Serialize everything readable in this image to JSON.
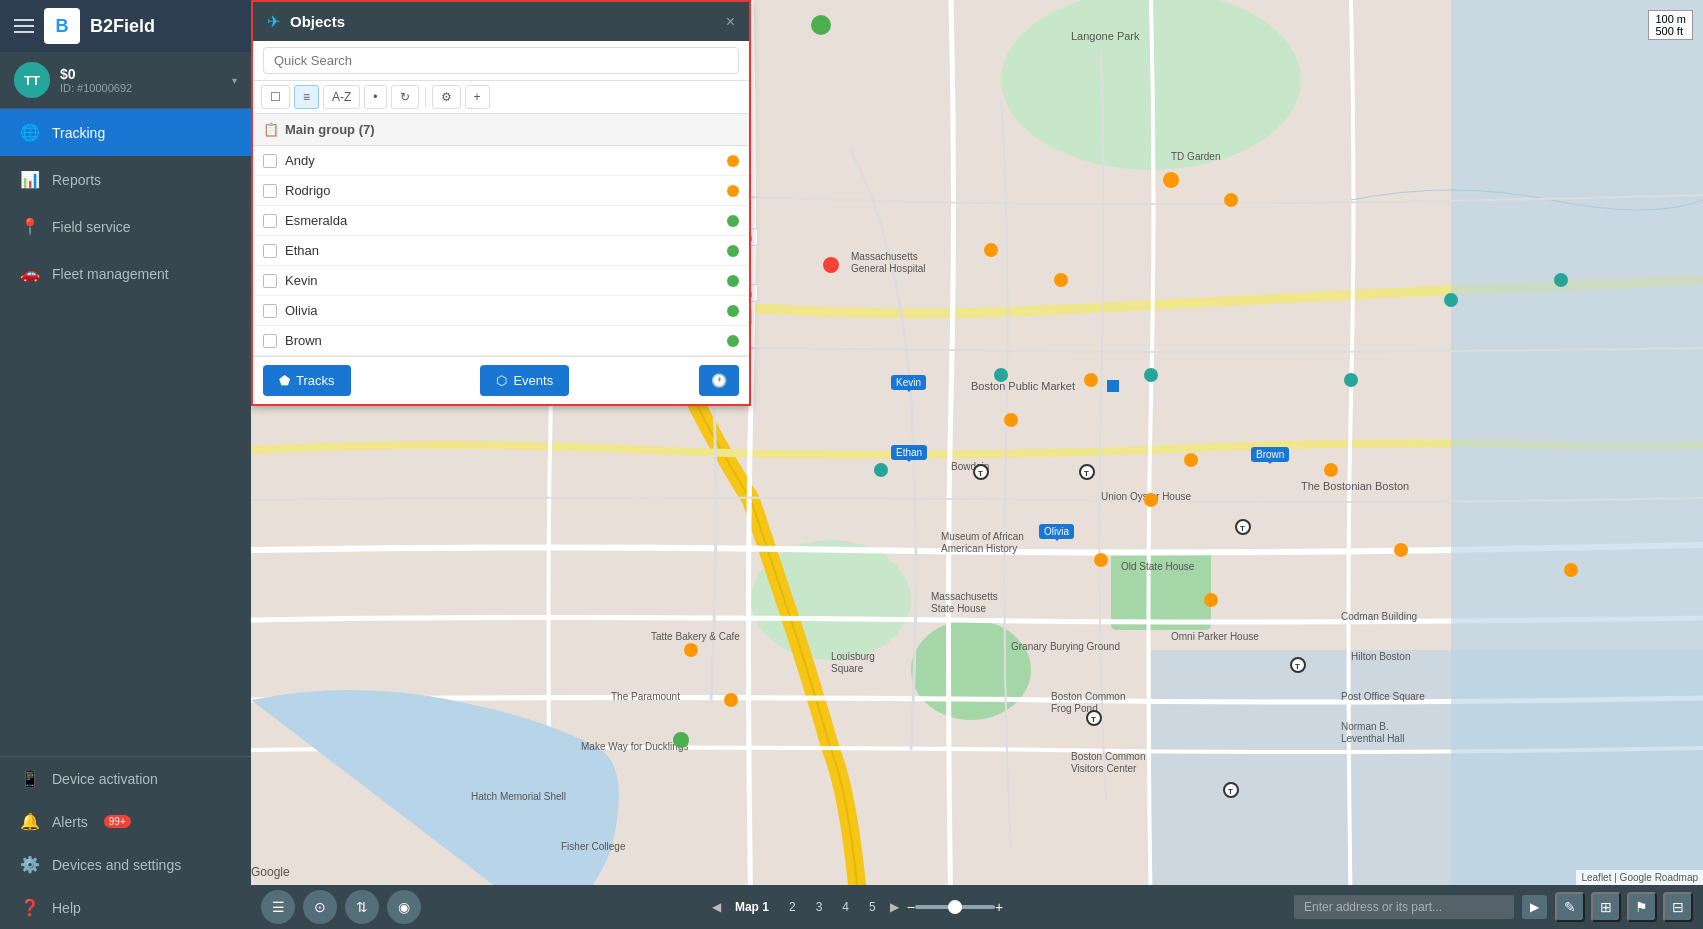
{
  "app": {
    "title": "B2Field",
    "logo_letters": "B"
  },
  "user": {
    "initials": "TT",
    "balance": "$0",
    "id": "ID: #10000692",
    "avatar_color": "#26a69a"
  },
  "sidebar": {
    "items": [
      {
        "id": "tracking",
        "label": "Tracking",
        "icon": "🌐",
        "active": true
      },
      {
        "id": "reports",
        "label": "Reports",
        "icon": "📊",
        "active": false
      },
      {
        "id": "field-service",
        "label": "Field service",
        "icon": "📍",
        "active": false
      },
      {
        "id": "fleet-management",
        "label": "Fleet management",
        "icon": "🚗",
        "active": false
      }
    ],
    "bottom_items": [
      {
        "id": "device-activation",
        "label": "Device activation",
        "icon": "📱",
        "badge": null
      },
      {
        "id": "alerts",
        "label": "Alerts",
        "icon": "🔔",
        "badge": "99+"
      },
      {
        "id": "devices-settings",
        "label": "Devices and settings",
        "icon": "⚙️",
        "badge": null
      },
      {
        "id": "help",
        "label": "Help",
        "icon": "❓",
        "badge": null
      }
    ]
  },
  "objects_panel": {
    "title": "Objects",
    "close_label": "×",
    "search_placeholder": "Quick Search",
    "toolbar_buttons": [
      {
        "id": "select-all",
        "label": "☐",
        "title": "Select all"
      },
      {
        "id": "list-view",
        "label": "≡",
        "title": "List view"
      },
      {
        "id": "sort-az",
        "label": "A-Z",
        "title": "Sort A-Z"
      },
      {
        "id": "dot-view",
        "label": "•",
        "title": "Dot view"
      },
      {
        "id": "refresh",
        "label": "↻",
        "title": "Refresh"
      },
      {
        "id": "filters",
        "label": "⚙",
        "title": "Filters"
      },
      {
        "id": "add",
        "label": "+",
        "title": "Add"
      }
    ],
    "group": {
      "name": "Main group (7)",
      "icon": "📋"
    },
    "objects": [
      {
        "name": "Andy",
        "status": "orange"
      },
      {
        "name": "Rodrigo",
        "status": "orange"
      },
      {
        "name": "Esmeralda",
        "status": "green"
      },
      {
        "name": "Ethan",
        "status": "green"
      },
      {
        "name": "Kevin",
        "status": "green"
      },
      {
        "name": "Olivia",
        "status": "green"
      },
      {
        "name": "Brown",
        "status": "green"
      }
    ],
    "footer_buttons": {
      "tracks": "Tracks",
      "events": "Events",
      "history_icon": "🕐"
    }
  },
  "map": {
    "scale_100m": "100 m",
    "scale_500ft": "500 ft",
    "markers": [
      {
        "name": "Kevin",
        "top": "385",
        "left": "860"
      },
      {
        "name": "Ethan",
        "top": "453",
        "left": "860"
      },
      {
        "name": "Olivia",
        "top": "533",
        "left": "1010"
      },
      {
        "name": "Brown",
        "top": "455",
        "left": "1220"
      }
    ]
  },
  "bottom_bar": {
    "map_tabs": [
      "Map",
      "1",
      "2",
      "3",
      "4",
      "5"
    ],
    "address_placeholder": "Enter address or its part...",
    "attribution": "Leaflet | Google Roadmap"
  }
}
